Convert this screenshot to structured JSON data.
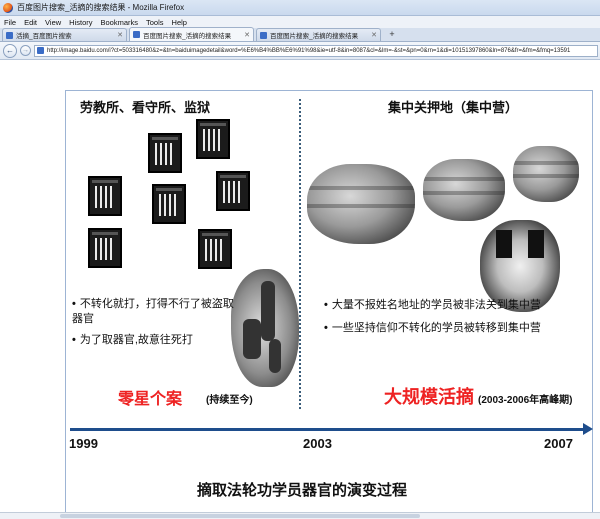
{
  "window": {
    "title": "百度图片搜索_活摘的搜索结果 - Mozilla Firefox"
  },
  "menu": [
    "File",
    "Edit",
    "View",
    "History",
    "Bookmarks",
    "Tools",
    "Help"
  ],
  "tabs": [
    {
      "label": "活摘_百度图片搜索"
    },
    {
      "label": "百度图片搜索_活摘的搜索结果"
    },
    {
      "label": "百度图片搜索_活摘的搜索结果"
    }
  ],
  "new_tab": "+",
  "url": "http://image.baidu.com/i?ct=503316480&z=&tn=baiduimagedetail&word=%E6%B4%BB%E6%91%98&ie=utf-8&in=8087&cl=&lm=-&st=&pn=0&rn=1&di=10151397860&ln=876&fr=&fm=&fmq=13591",
  "infographic": {
    "left_heading": "劳教所、看守所、监狱",
    "right_heading": "集中关押地（集中营）",
    "left_bullets": [
      "不转化就打，打得不行了被盗取器官",
      "为了取器官,故意往死打"
    ],
    "right_bullets": [
      "大量不报姓名地址的学员被非法关到集中营",
      "一些坚持信仰不转化的学员被转移到集中营"
    ],
    "left_label": "零星个案",
    "left_note": "(持续至今)",
    "right_label": "大规模活摘",
    "right_note": "(2003-2006年高峰期)",
    "years": [
      "1999",
      "2003",
      "2007"
    ],
    "caption": "摘取法轮功学员器官的演变过程",
    "accent_red": "#ee2222",
    "timeline_color": "#1e4d8c"
  }
}
